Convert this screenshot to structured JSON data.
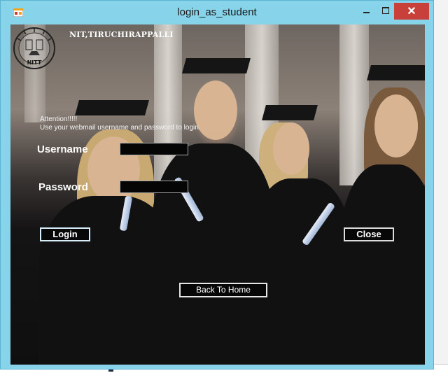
{
  "window": {
    "title": "login_as_student",
    "close_glyph": "✕"
  },
  "header": {
    "institution": "NIT,TIRUCHIRAPPALLI",
    "logo_text": "NITT"
  },
  "form": {
    "attention_line1": "Attention!!!!!",
    "attention_line2": "Use your webmail username and password to login.",
    "username_label": "Username",
    "password_label": "Password",
    "username_value": "",
    "password_value": ""
  },
  "buttons": {
    "login": "Login",
    "close": "Close",
    "back_home": "Back To Home"
  },
  "colors": {
    "titlebar": "#86d3ea",
    "close_button": "#c7403a",
    "field_background": "#050505"
  },
  "icons": {
    "app": "app-icon",
    "minimize": "minimize-icon",
    "maximize": "maximize-icon",
    "close": "close-icon"
  }
}
